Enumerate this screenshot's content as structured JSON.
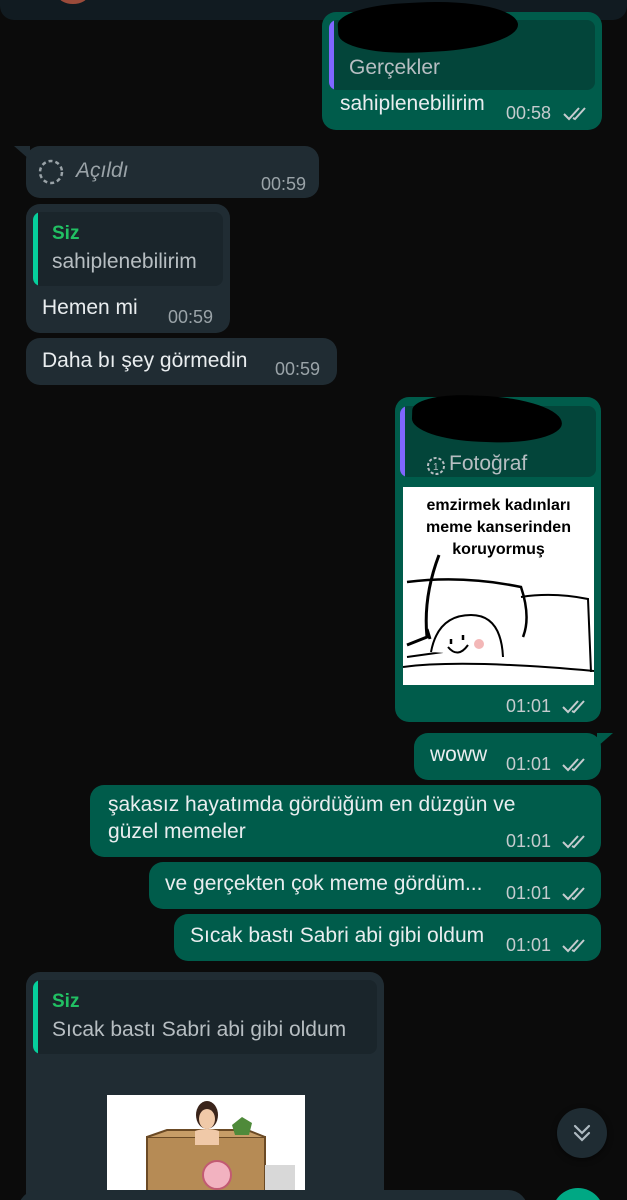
{
  "chat": {
    "msg1": {
      "quote_text": "Gerçekler",
      "text": "sahiplenebilirim",
      "time": "00:58"
    },
    "msg2": {
      "text": "Açıldı",
      "time": "00:59"
    },
    "msg3": {
      "quote_author": "Siz",
      "quote_text": "sahiplenebilirim",
      "text": "Hemen mi",
      "time": "00:59"
    },
    "msg4": {
      "text": "Daha bı şey görmedin",
      "time": "00:59"
    },
    "msg5": {
      "quote_label": "Fotoğraf",
      "image_text": [
        "emzirmek kadınları",
        "meme kanserinden",
        "koruyormuş"
      ],
      "time": "01:01"
    },
    "msg6": {
      "text": "woww",
      "time": "01:01"
    },
    "msg7": {
      "text_line1": "şakasız hayatımda gördüğüm en düzgün ve",
      "text_line2": "güzel memeler",
      "time": "01:01"
    },
    "msg8": {
      "text": "ve gerçekten çok meme gördüm...",
      "time": "01:01"
    },
    "msg9": {
      "text": "Sıcak bastı Sabri abi gibi oldum",
      "time": "01:01"
    },
    "msg10": {
      "quote_author": "Siz",
      "quote_text": "Sıcak bastı Sabri abi gibi oldum"
    }
  },
  "icons": {
    "read_receipt": "double-check-icon",
    "view_once": "view-once-icon",
    "scroll_down": "chevron-double-down-icon"
  },
  "colors": {
    "incoming_bubble": "#202c33",
    "outgoing_bubble": "#005c4b",
    "read_tick": "#53bdeb",
    "quote_author": "#21c063"
  }
}
